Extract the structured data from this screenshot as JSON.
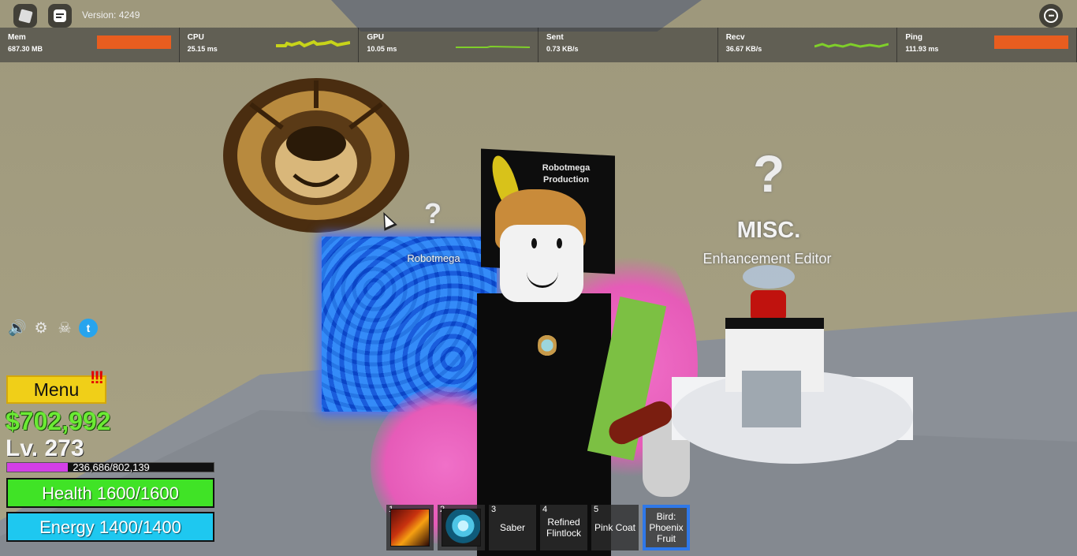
{
  "topbar": {
    "version": "Version: 4249",
    "roblox_icon": "roblox-logo-icon",
    "chat_icon": "chat-icon",
    "more_icon": "more-options-icon"
  },
  "stats": [
    {
      "name": "Mem",
      "value": "687.30 MB",
      "graph": "block",
      "color": "#e85d1f"
    },
    {
      "name": "CPU",
      "value": "25.15 ms",
      "graph": "line",
      "color": "#c8d41a"
    },
    {
      "name": "GPU",
      "value": "10.05 ms",
      "graph": "line",
      "color": "#7fcf2a"
    },
    {
      "name": "Sent",
      "value": "0.73 KB/s",
      "graph": "line",
      "color": "#7fcf2a"
    },
    {
      "name": "Recv",
      "value": "36.67 KB/s",
      "graph": "line",
      "color": "#7fcf2a"
    },
    {
      "name": "Ping",
      "value": "111.93 ms",
      "graph": "block",
      "color": "#e85d1f"
    }
  ],
  "world": {
    "player_name": "Robotmega",
    "sign_text": "Robotmega Production",
    "misc_title": "MISC.",
    "npc_name": "Enhancement Editor",
    "question_mark": "?"
  },
  "hud": {
    "menu_label": "Menu",
    "alert": "!!!",
    "money": "$702,992",
    "level": "Lv. 273",
    "xp_text": "236,686/802,139",
    "xp_fraction": 0.295,
    "health": "Health 1600/1600",
    "energy": "Energy 1400/1400",
    "quick_icons": [
      "speaker-icon",
      "gear-icon",
      "crossed-swords-icon",
      "twitter-icon"
    ]
  },
  "hotbar": [
    {
      "num": "1",
      "label": "",
      "icon": "fire-fist-icon"
    },
    {
      "num": "2",
      "label": "",
      "icon": "phoenix-bird-icon"
    },
    {
      "num": "3",
      "label": "Saber"
    },
    {
      "num": "4",
      "label": "Refined Flintlock"
    },
    {
      "num": "5",
      "label": "Pink Coat"
    },
    {
      "num": "",
      "label": "Bird: Phoenix Fruit",
      "selected": true
    }
  ]
}
